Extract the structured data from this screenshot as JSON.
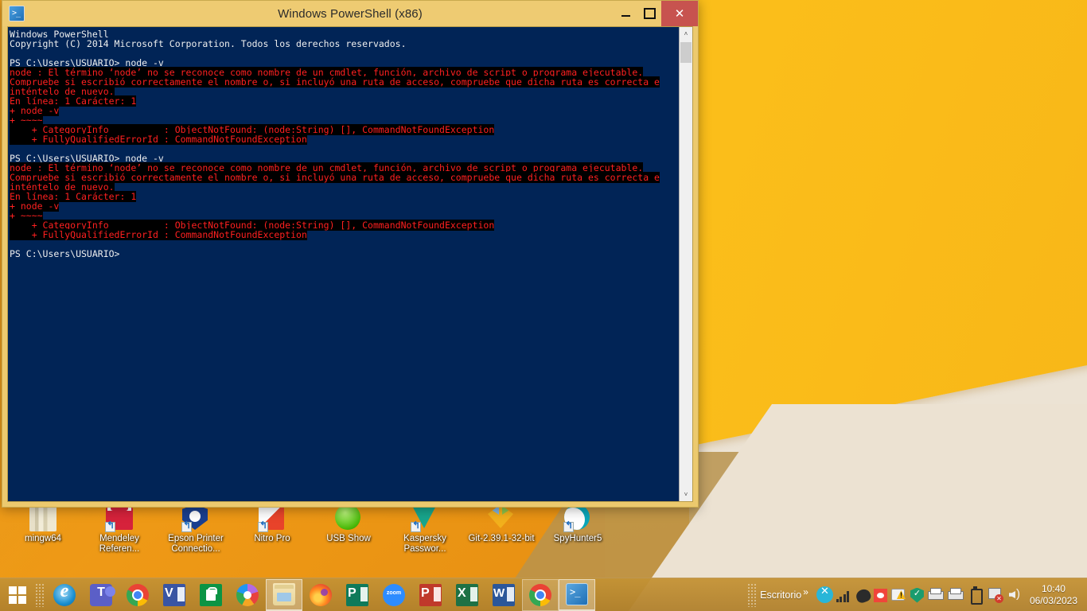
{
  "window": {
    "title": "Windows PowerShell (x86)",
    "app_icon": "powershell-icon",
    "minimize_label": "",
    "maximize_label": "",
    "close_label": "✕"
  },
  "console": {
    "lines": [
      {
        "text": "Windows PowerShell",
        "type": "normal"
      },
      {
        "text": "Copyright (C) 2014 Microsoft Corporation. Todos los derechos reservados.",
        "type": "normal"
      },
      {
        "text": "",
        "type": "normal"
      },
      {
        "text": "PS C:\\Users\\USUARIO> node -v",
        "type": "normal"
      },
      {
        "text": "node : El término ‘node’ no se reconoce como nombre de un cmdlet, función, archivo de script o programa ejecutable.",
        "type": "error"
      },
      {
        "text": "Compruebe si escribió correctamente el nombre o, si incluyó una ruta de acceso, compruebe que dicha ruta es correcta e",
        "type": "error"
      },
      {
        "text": "inténtelo de nuevo.",
        "type": "error"
      },
      {
        "text": "En línea: 1 Carácter: 1",
        "type": "error"
      },
      {
        "text": "+ node -v",
        "type": "error"
      },
      {
        "text": "+ ~~~~",
        "type": "error"
      },
      {
        "text": "    + CategoryInfo          : ObjectNotFound: (node:String) [], CommandNotFoundException",
        "type": "error"
      },
      {
        "text": "    + FullyQualifiedErrorId : CommandNotFoundException",
        "type": "error"
      },
      {
        "text": "",
        "type": "normal"
      },
      {
        "text": "PS C:\\Users\\USUARIO> node -v",
        "type": "normal"
      },
      {
        "text": "node : El término ‘node’ no se reconoce como nombre de un cmdlet, función, archivo de script o programa ejecutable.",
        "type": "error"
      },
      {
        "text": "Compruebe si escribió correctamente el nombre o, si incluyó una ruta de acceso, compruebe que dicha ruta es correcta e",
        "type": "error"
      },
      {
        "text": "inténtelo de nuevo.",
        "type": "error"
      },
      {
        "text": "En línea: 1 Carácter: 1",
        "type": "error"
      },
      {
        "text": "+ node -v",
        "type": "error"
      },
      {
        "text": "+ ~~~~",
        "type": "error"
      },
      {
        "text": "    + CategoryInfo          : ObjectNotFound: (node:String) [], CommandNotFoundException",
        "type": "error"
      },
      {
        "text": "    + FullyQualifiedErrorId : CommandNotFoundException",
        "type": "error"
      },
      {
        "text": "",
        "type": "normal"
      },
      {
        "text": "PS C:\\Users\\USUARIO>",
        "type": "normal"
      }
    ],
    "background_color": "#012456",
    "text_color": "#eeeeee",
    "error_color": "#ff2020",
    "error_background": "#000000"
  },
  "scrollbar": {
    "up_arrow": "˄",
    "down_arrow": "˅"
  },
  "desktop_icons": [
    {
      "label": "mingw64",
      "icon": "mingw64-icon",
      "shortcut": false,
      "art": "ic-mingw"
    },
    {
      "label": "Mendeley Referen...",
      "icon": "mendeley-icon",
      "shortcut": true,
      "art": "ic-mendeley"
    },
    {
      "label": "Epson Printer Connectio...",
      "icon": "epson-printer-icon",
      "shortcut": true,
      "art": "ic-epson"
    },
    {
      "label": "Nitro Pro",
      "icon": "nitro-pro-icon",
      "shortcut": true,
      "art": "ic-nitro"
    },
    {
      "label": "USB Show",
      "icon": "usb-show-icon",
      "shortcut": false,
      "art": "ic-usb"
    },
    {
      "label": "Kaspersky Passwor...",
      "icon": "kaspersky-password-icon",
      "shortcut": true,
      "art": "ic-kaspersky"
    },
    {
      "label": "Git-2.39.1-32-bit",
      "icon": "git-installer-icon",
      "shortcut": false,
      "art": "ic-git"
    },
    {
      "label": "SpyHunter5",
      "icon": "spyhunter5-icon",
      "shortcut": true,
      "art": "ic-spy"
    }
  ],
  "taskbar": {
    "start_button": "start-button",
    "items": [
      {
        "name": "internet-explorer",
        "art": "gl-ie",
        "state": "pinned"
      },
      {
        "name": "microsoft-teams",
        "art": "gl-teams",
        "state": "pinned"
      },
      {
        "name": "google-chrome",
        "art": "gl-chrome",
        "state": "pinned"
      },
      {
        "name": "microsoft-visio",
        "art": "gl-visio",
        "state": "pinned"
      },
      {
        "name": "microsoft-store",
        "art": "gl-store",
        "state": "pinned"
      },
      {
        "name": "picasa",
        "art": "gl-picasa",
        "state": "pinned"
      },
      {
        "name": "file-explorer",
        "art": "gl-explorer",
        "state": "active"
      },
      {
        "name": "mozilla-firefox",
        "art": "gl-firefox",
        "state": "pinned"
      },
      {
        "name": "microsoft-publisher",
        "art": "gl-pub",
        "state": "pinned"
      },
      {
        "name": "zoom",
        "art": "gl-zoom",
        "state": "pinned"
      },
      {
        "name": "microsoft-powerpoint",
        "art": "gl-ppt",
        "state": "pinned"
      },
      {
        "name": "microsoft-excel",
        "art": "gl-xls",
        "state": "pinned"
      },
      {
        "name": "microsoft-word",
        "art": "gl-word",
        "state": "pinned"
      },
      {
        "name": "google-chrome-window",
        "art": "gl-chrome",
        "state": "running"
      },
      {
        "name": "windows-powershell",
        "art": "gl-psh",
        "state": "active"
      }
    ]
  },
  "tray": {
    "desktop_label": "Escritorio",
    "chevron": "»",
    "icons": [
      {
        "name": "cyan-x-icon",
        "art": "ti-cyan"
      },
      {
        "name": "signal-bars-icon",
        "art": "ti-bars"
      },
      {
        "name": "dark-app-icon",
        "art": "ti-dark"
      },
      {
        "name": "red-alert-icon",
        "art": "ti-red"
      },
      {
        "name": "warning-shield-icon",
        "art": "ti-warn"
      },
      {
        "name": "security-shield-icon",
        "art": "ti-shield"
      },
      {
        "name": "printer-icon-1",
        "art": "ti-printer"
      },
      {
        "name": "printer-icon-2",
        "art": "ti-printer"
      },
      {
        "name": "battery-icon",
        "art": "ti-battery"
      },
      {
        "name": "action-center-flag-icon",
        "art": "ti-flag"
      },
      {
        "name": "volume-icon",
        "art": "ti-vol"
      }
    ],
    "time": "10:40",
    "date": "06/03/2023"
  },
  "colors": {
    "wallpaper_yellow": "#f2b01c",
    "wallpaper_orange": "#ef9a16",
    "wallpaper_beige": "#ece2d2",
    "titlebar": "#eecb72",
    "close_button": "#c7534f",
    "console_bg": "#012456",
    "taskbar": "#c49234"
  }
}
